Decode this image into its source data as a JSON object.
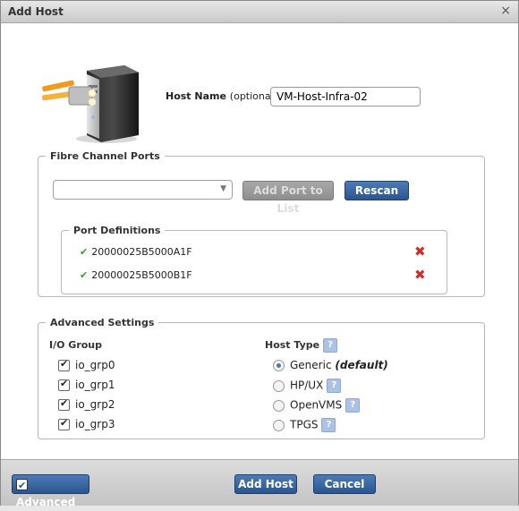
{
  "window": {
    "title": "Add Host",
    "close_glyph": "×"
  },
  "host_name": {
    "label": "Host Name",
    "optional": "(optional):",
    "value": "VM-Host-Infra-02"
  },
  "fibre_channel": {
    "legend": "Fibre Channel Ports",
    "select_value": "",
    "add_port_label": "Add Port to List",
    "rescan_label": "Rescan",
    "port_definitions": {
      "legend": "Port Definitions",
      "ports": [
        {
          "wwpn": "20000025B5000A1F"
        },
        {
          "wwpn": "20000025B5000B1F"
        }
      ]
    }
  },
  "advanced_settings": {
    "legend": "Advanced Settings",
    "io_group": {
      "heading": "I/O Group",
      "items": [
        {
          "label": "io_grp0",
          "checked": true
        },
        {
          "label": "io_grp1",
          "checked": true
        },
        {
          "label": "io_grp2",
          "checked": true
        },
        {
          "label": "io_grp3",
          "checked": true
        }
      ]
    },
    "host_type": {
      "heading": "Host Type",
      "options": [
        {
          "label": "Generic",
          "suffix": "(default)",
          "selected": true
        },
        {
          "label": "HP/UX",
          "selected": false
        },
        {
          "label": "OpenVMS",
          "selected": false
        },
        {
          "label": "TPGS",
          "selected": false
        }
      ]
    }
  },
  "footer": {
    "advanced_label": "Advanced",
    "add_host_label": "Add Host",
    "cancel_label": "Cancel"
  },
  "icons": {
    "help": "?",
    "delete": "✖",
    "check": "✔",
    "dropdown": "▼"
  },
  "colors": {
    "accent": "#2a5590",
    "check_green": "#3a9a2d",
    "delete_red": "#d12c2c"
  }
}
